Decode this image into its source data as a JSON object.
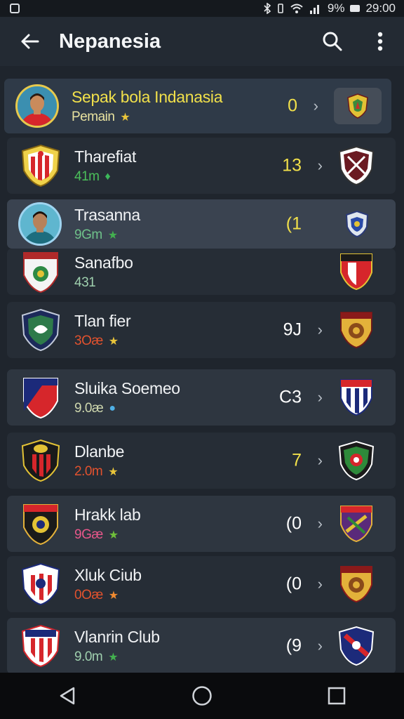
{
  "status_bar": {
    "time": "29:00",
    "battery": "9%"
  },
  "app_bar": {
    "title": "Nepanesia"
  },
  "rows": [
    {
      "name": "Sepak bola Indanasia",
      "sub": "Pemain",
      "score": "0",
      "sub_color": "#e8e2a0",
      "score_color": "#f1e04a",
      "star": "★",
      "star_color": "#e8c43a",
      "highlighted": true
    },
    {
      "name": "Tharefiat",
      "sub": "41m",
      "score": "13",
      "sub_color": "#4bbf5a",
      "score_color": "#f1e04a",
      "star": "♦",
      "star_color": "#3cb85a"
    },
    {
      "name": "Trasanna",
      "sub": "9Gm",
      "score": "(1",
      "sub_color": "#6fc18a",
      "score_color": "#f1e04a",
      "star": "★",
      "star_color": "#43b04f"
    },
    {
      "name": "Sanafbo",
      "sub": "431",
      "score": "",
      "sub_color": "#9fd0ae",
      "score_color": "#ffffff"
    },
    {
      "name": "Tlan fier",
      "sub": "3Oæ",
      "score": "9J",
      "sub_color": "#e2522e",
      "score_color": "#ffffff",
      "star": "★",
      "star_color": "#e8c43a"
    },
    {
      "name": "Sluika Soemeo",
      "sub": "9.0æ",
      "score": "C3",
      "sub_color": "#cfd8ae",
      "score_color": "#ffffff",
      "star": "●",
      "star_color": "#4fb0e6"
    },
    {
      "name": "Dlanbe",
      "sub": "2.0m",
      "score": "7",
      "sub_color": "#e2522e",
      "score_color": "#f1e04a",
      "star": "★",
      "star_color": "#e8c43a"
    },
    {
      "name": "Hrakk lab",
      "sub": "9Gæ",
      "score": "(0",
      "sub_color": "#e8578a",
      "score_color": "#ffffff",
      "star": "★",
      "star_color": "#6fbf3a"
    },
    {
      "name": "Xluk Ciub",
      "sub": "0Oæ",
      "score": "(0",
      "sub_color": "#e2522e",
      "score_color": "#ffffff",
      "star": "★",
      "star_color": "#f08a30"
    },
    {
      "name": "Vlanrin Club",
      "sub": "9.0m",
      "score": "(9",
      "sub_color": "#9fd0ae",
      "score_color": "#ffffff",
      "star": "★",
      "star_color": "#43b04f"
    }
  ]
}
